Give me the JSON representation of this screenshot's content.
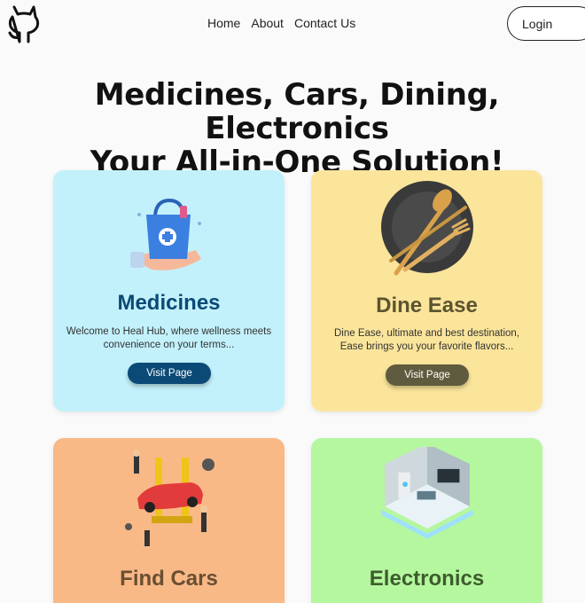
{
  "nav": {
    "home": "Home",
    "about": "About",
    "contact": "Contact Us",
    "login": "Login",
    "logo_icon": "github-icon"
  },
  "hero": {
    "line1": "Medicines, Cars, Dining, Electronics",
    "line2": "Your All-in-One Solution!"
  },
  "cards": [
    {
      "title": "Medicines",
      "description": "Welcome to Heal Hub, where wellness meets convenience on your terms...",
      "button": "Visit Page",
      "bg": "#c2f1fb",
      "title_color": "#0b4a76",
      "button_color": "#0b4a76",
      "icon": "medicine-bag-icon"
    },
    {
      "title": "Dine Ease",
      "description": "Dine Ease, ultimate and best destination, Ease brings you your favorite flavors...",
      "button": "Visit Page",
      "bg": "#fbe59b",
      "title_color": "#5c5430",
      "button_color": "#5f5b3e",
      "icon": "plate-cutlery-icon"
    },
    {
      "title": "Find Cars",
      "bg": "#f8b987",
      "title_color": "#6a4e32",
      "icon": "car-garage-icon"
    },
    {
      "title": "Electronics",
      "bg": "#b5f79f",
      "title_color": "#3d5d2c",
      "icon": "smart-room-icon"
    }
  ]
}
